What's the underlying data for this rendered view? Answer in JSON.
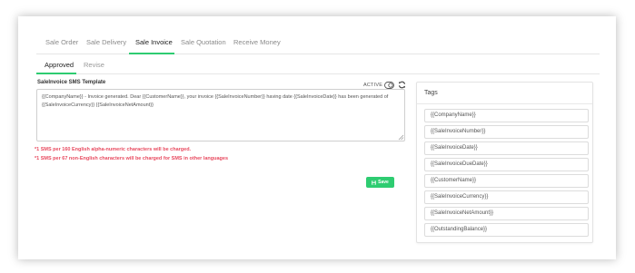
{
  "tabs": [
    {
      "label": "Sale Order"
    },
    {
      "label": "Sale Delivery"
    },
    {
      "label": "Sale Invoice"
    },
    {
      "label": "Sale Quotation"
    },
    {
      "label": "Receive Money"
    }
  ],
  "subtabs": [
    {
      "label": "Approved"
    },
    {
      "label": "Revise"
    }
  ],
  "template": {
    "label": "SaleInvoice SMS Template",
    "status": "ACTIVE",
    "text": "{{CompanyName}} - Invoice generated. Dear {{CustomerName}}, your invoice {{SaleInvoiceNumber}} having date {{SaleInvoiceDate}} has been generated of {{SaleInvoiceCurrency}} {{SaleInvoiceNetAmount}}"
  },
  "notes": [
    "*1 SMS per 160 English alpha-numeric characters will be charged.",
    "*1 SMS per 67 non-English characters will be charged for SMS in other languages"
  ],
  "save": {
    "label": "Save"
  },
  "tags": {
    "title": "Tags",
    "items": [
      "{{CompanyName}}",
      "{{SaleInvoiceNumber}}",
      "{{SaleInvoiceDate}}",
      "{{SaleInvoiceDueDate}}",
      "{{CustomerName}}",
      "{{SaleInvoiceCurrency}}",
      "{{SaleInvoiceNetAmount}}",
      "{{OutstandingBalance}}"
    ]
  },
  "colors": {
    "accent": "#2ecc71",
    "warning": "#e84a5f"
  },
  "icons": {
    "status_toggle": "toggle-icon",
    "refresh": "refresh-icon",
    "save": "floppy-disk-icon"
  }
}
